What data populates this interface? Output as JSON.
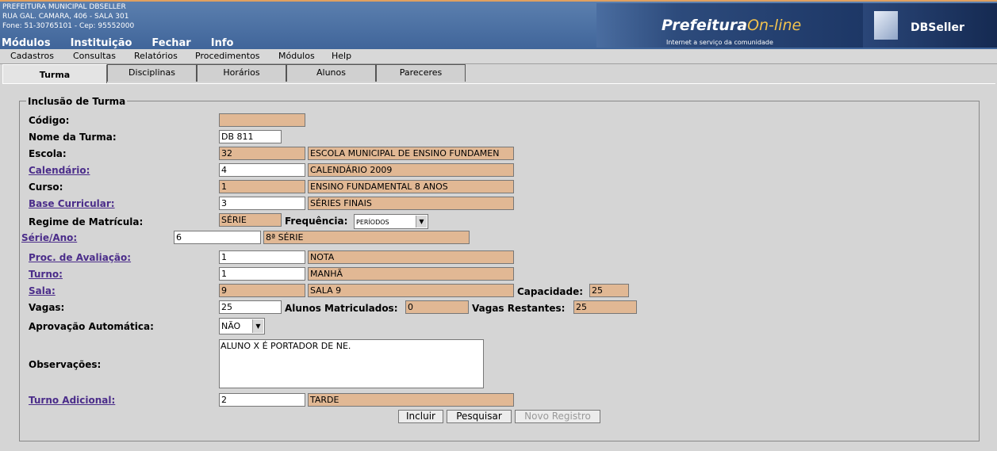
{
  "header": {
    "org_line1": "PREFEITURA MUNICIPAL DBSELLER",
    "org_line2": "RUA GAL. CAMARA, 406 - SALA 301",
    "org_line3": "Fone: 51-30765101  -  Cep: 95552000",
    "main_menu": [
      "Módulos",
      "Instituição",
      "Fechar",
      "Info"
    ],
    "logo_prefeitura": "Prefeitura",
    "logo_online": "On-line",
    "logo_tagline": "Internet a serviço da comunidade",
    "logo_dbseller": "DBSeller"
  },
  "menubar": [
    "Cadastros",
    "Consultas",
    "Relatórios",
    "Procedimentos",
    "Módulos",
    "Help"
  ],
  "tabs": [
    "Turma",
    "Disciplinas",
    "Horários",
    "Alunos",
    "Pareceres"
  ],
  "form": {
    "legend": "Inclusão de Turma",
    "codigo_label": "Código:",
    "codigo_value": "",
    "nome_label": "Nome da Turma:",
    "nome_value": "DB 811",
    "escola_label": "Escola:",
    "escola_code": "32",
    "escola_name": "ESCOLA MUNICIPAL DE ENSINO FUNDAMEN",
    "calendario_label": "Calendário:",
    "calendario_code": "4",
    "calendario_name": "CALENDÁRIO 2009",
    "curso_label": "Curso:",
    "curso_code": "1",
    "curso_name": "ENSINO FUNDAMENTAL 8 ANOS",
    "base_label": "Base Curricular:",
    "base_code": "3",
    "base_name": "SÉRIES FINAIS",
    "regime_label": "Regime de Matrícula:",
    "regime_value": "SÉRIE",
    "frequencia_label": "Frequência:",
    "frequencia_value": "PERÍODOS",
    "serie_label": "Série/Ano:",
    "serie_code": "6",
    "serie_name": "8ª SÉRIE",
    "proc_label": "Proc. de Avaliação:",
    "proc_code": "1",
    "proc_name": "NOTA",
    "turno_label": "Turno:",
    "turno_code": "1",
    "turno_name": "MANHÃ",
    "sala_label": "Sala:",
    "sala_code": "9",
    "sala_name": "SALA 9",
    "capacidade_label": "Capacidade:",
    "capacidade_value": "25",
    "vagas_label": "Vagas:",
    "vagas_value": "25",
    "matriculados_label": "Alunos Matriculados:",
    "matriculados_value": "0",
    "restantes_label": "Vagas Restantes:",
    "restantes_value": "25",
    "aprovacao_label": "Aprovação Automática:",
    "aprovacao_value": "NÃO",
    "observacoes_label": "Observações:",
    "observacoes_value": "ALUNO X É PORTADOR DE NE.",
    "turno_adicional_label": "Turno Adicional:",
    "turno_adicional_code": "2",
    "turno_adicional_name": "TARDE"
  },
  "buttons": {
    "incluir": "Incluir",
    "pesquisar": "Pesquisar",
    "novo_registro": "Novo Registro"
  }
}
